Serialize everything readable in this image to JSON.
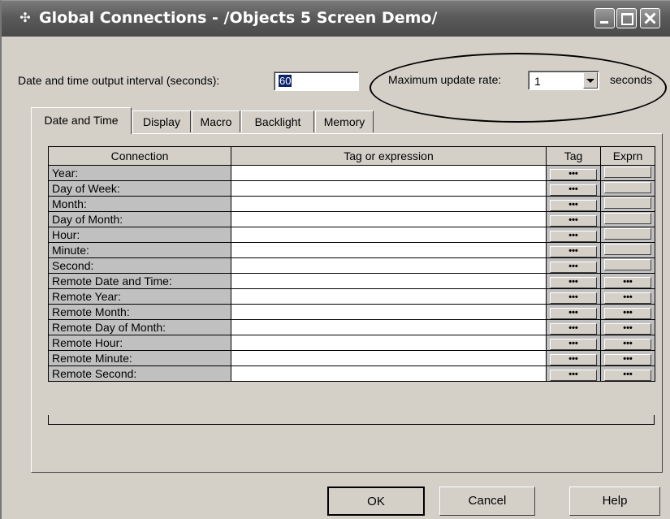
{
  "window": {
    "title": "Global Connections - /Objects 5 Screen Demo/"
  },
  "settings": {
    "interval_label": "Date and time output interval (seconds):",
    "interval_value": "60",
    "rate_label": "Maximum update rate:",
    "rate_value": "1",
    "rate_unit": "seconds"
  },
  "tabs": [
    {
      "label": "Date and Time",
      "active": true
    },
    {
      "label": "Display",
      "active": false
    },
    {
      "label": "Macro",
      "active": false
    },
    {
      "label": "Backlight",
      "active": false
    },
    {
      "label": "Memory",
      "active": false
    }
  ],
  "grid": {
    "columns": [
      "Connection",
      "Tag or expression",
      "Tag",
      "Exprn"
    ],
    "button_text": "•••",
    "rows": [
      {
        "name": "Year:",
        "expression": "",
        "exprn_enabled": false
      },
      {
        "name": "Day of Week:",
        "expression": "",
        "exprn_enabled": false
      },
      {
        "name": "Month:",
        "expression": "",
        "exprn_enabled": false
      },
      {
        "name": "Day of Month:",
        "expression": "",
        "exprn_enabled": false
      },
      {
        "name": "Hour:",
        "expression": "",
        "exprn_enabled": false
      },
      {
        "name": "Minute:",
        "expression": "",
        "exprn_enabled": false
      },
      {
        "name": "Second:",
        "expression": "",
        "exprn_enabled": false
      },
      {
        "name": "Remote Date and Time:",
        "expression": "",
        "exprn_enabled": true
      },
      {
        "name": "Remote Year:",
        "expression": "",
        "exprn_enabled": true
      },
      {
        "name": "Remote Month:",
        "expression": "",
        "exprn_enabled": true
      },
      {
        "name": "Remote Day of Month:",
        "expression": "",
        "exprn_enabled": true
      },
      {
        "name": "Remote Hour:",
        "expression": "",
        "exprn_enabled": true
      },
      {
        "name": "Remote Minute:",
        "expression": "",
        "exprn_enabled": true
      },
      {
        "name": "Remote Second:",
        "expression": "",
        "exprn_enabled": true
      }
    ]
  },
  "buttons": {
    "ok": "OK",
    "cancel": "Cancel",
    "help": "Help"
  },
  "icons": {
    "app": "app-window-icon",
    "minimize": "minimize-icon",
    "maximize": "maximize-icon",
    "close": "close-icon",
    "dropdown": "chevron-down-icon"
  }
}
